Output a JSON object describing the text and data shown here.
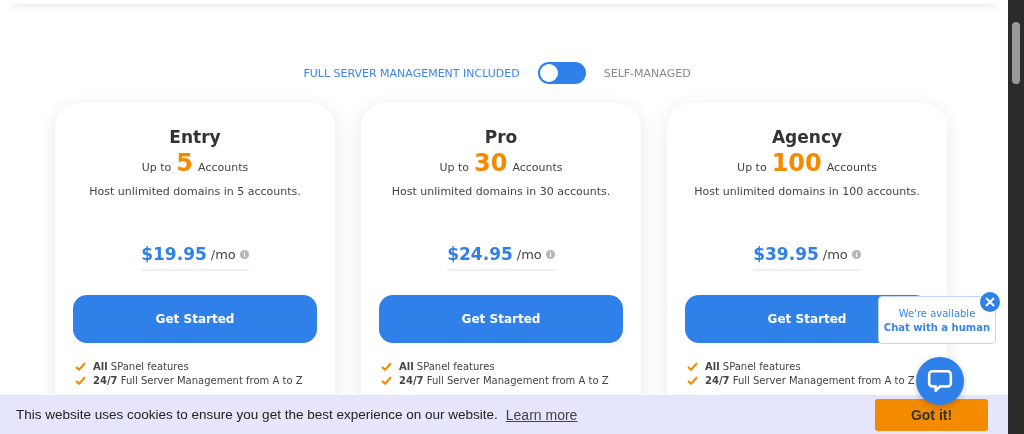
{
  "management_toggle": {
    "left_label": "FULL SERVER MANAGEMENT INCLUDED",
    "right_label": "SELF-MANAGED",
    "self_managed": false
  },
  "plans": [
    {
      "name": "Entry",
      "up_to": "Up to",
      "count": "5",
      "count_unit": "Accounts",
      "description": "Host unlimited domains in 5 accounts.",
      "price": "$19.95",
      "period": "/mo",
      "button": "Get Started",
      "features": [
        "**All** SPanel features",
        "**24/7** Full Server Management from A to Z"
      ]
    },
    {
      "name": "Pro",
      "up_to": "Up to",
      "count": "30",
      "count_unit": "Accounts",
      "description": "Host unlimited domains in 30 accounts.",
      "price": "$24.95",
      "period": "/mo",
      "button": "Get Started",
      "features": [
        "**All** SPanel features",
        "**24/7** Full Server Management from A to Z"
      ]
    },
    {
      "name": "Agency",
      "up_to": "Up to",
      "count": "100",
      "count_unit": "Accounts",
      "description": "Host unlimited domains in 100 accounts.",
      "price": "$39.95",
      "period": "/mo",
      "button": "Get Started",
      "features": [
        "**All** SPanel features",
        "**24/7** Full Server Management from A to Z"
      ]
    }
  ],
  "chat_popup": {
    "line_1": "We're available",
    "line_2": "Chat with a human"
  },
  "cookie_bar": {
    "message": "This website uses cookies to ensure you get the best experience on our website.",
    "link": "Learn more",
    "button": "Got it!"
  }
}
